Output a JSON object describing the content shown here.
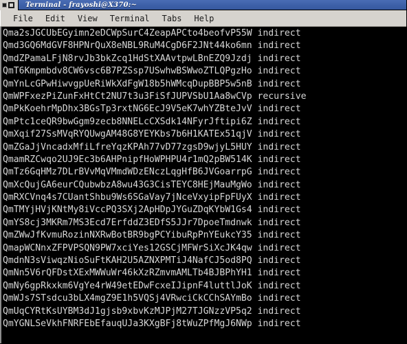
{
  "window": {
    "title": "Terminal - frayoshi@X370:~",
    "controls": [
      {
        "name": "minimize-button",
        "glyph": "minimize"
      },
      {
        "name": "maximize-button",
        "glyph": "maximize"
      }
    ]
  },
  "menubar": {
    "items": [
      {
        "label": "File"
      },
      {
        "label": "Edit"
      },
      {
        "label": "View"
      },
      {
        "label": "Terminal"
      },
      {
        "label": "Tabs"
      },
      {
        "label": "Help"
      }
    ]
  },
  "colors": {
    "titlebar_bg": "#3f62aa",
    "titlebar_text": "#ffffff",
    "chrome_bg": "#d6d3ce",
    "terminal_bg": "#000000",
    "terminal_fg": "#d8d8d8"
  },
  "terminal": {
    "lines": [
      "Qma2sJGCUbEGyimn2eDCWpSurC4ZeapAPCto4beofvP55W indirect",
      "Qmd3GQ6MdGVF8HPNrQuX8eNBL9RuM4CgD6F2JNt44ko6mn indirect",
      "QmdZPamaLFjN8rvJb3bkZcq1HdStXAAvtpwLBnEZQ9Jzdj indirect",
      "QmT6Kmpmbdv8CW6vsc6B7PZSsp7USwhwBSWwoZTLQPgzHo indirect",
      "QmYnLcGPwHiwvgpUeRiWkXdFgW18b5hWMcqDupBBP5w5nB indirect",
      "QmWPFxezPiZunFxHtCt2NU7t3u3FiSfJUPVSbU1Aa8wCVp recursive",
      "QmPkKoehrMpDhx3BGsTp3rxtNG6EcJ9V5eK7whYZBteJvV indirect",
      "QmPtc1ceQR9bwGgm9zecb8NNELcCXSdk14NFyrJftipi6Z indirect",
      "QmXqif27SsMVqRYQUwgAM48G8YEYKbs7b6H1KATEx51qjV indirect",
      "QmZGaJjVncadxMfiLfreYqzKPAh77vD77zgsD9wjyL5HUY indirect",
      "QmamRZCwqo2UJ9Ec3b6AHPnipfHoWPHPU4r1mQ2pBW514K indirect",
      "QmTz6GqHMz7DLrBVvMqVMmdWDzENczLqgHfB6JVGoarrpG indirect",
      "QmXcQujGA6eurCQubwbzA8wu43G3CisTEYC8HEjMauMgWo indirect",
      "QmRXCVnq4s7CUantShbu9Ws6SGaVay7jNceVxyipFpFUyX indirect",
      "QmTMYjHVjKNtMy8iVccPQ3SXj2ApHDpJYGuZDqKYbW1Gs4 indirect",
      "QmYS8cj3MKRm7MS3Ecd7ErfddZ3EDfS5JJr7DpoeTmdnwk indirect",
      "QmZWwJfKvmuRozinNXRwBotBR9bgPCYibuRpPnYEukcY35 indirect",
      "QmapWCNnxZFPVPSQN9PW7xciYes12GSCjMFWrSiXcJK4qw indirect",
      "QmdnN3sViwqzNioSuFtKAH2U5AZNXPMTiJ4NafCJ5od8PQ indirect",
      "QmNn5V6rQFDstXExMWWuWr46kXzRZmvmAMLTb4BJBPhYH1 indirect",
      "QmNy6gpRkxkm6VgYe4rW49etEDwFcxeIJipnF4luttlJoK indirect",
      "QmWJs7STsdcu3bLX4mgZ9E1h5VQSj4VRwciCkCChSAYmBo indirect",
      "QmUqCYRtKsUYBM3dJ1gjsb9xbvKzMJPjM27TJGNzzVP5q2 indirect",
      "QmYGNLSeVkhFNRFEbEfauqUJa3KXgBFj8tWuZPfMgJ6NWp indirect"
    ]
  }
}
